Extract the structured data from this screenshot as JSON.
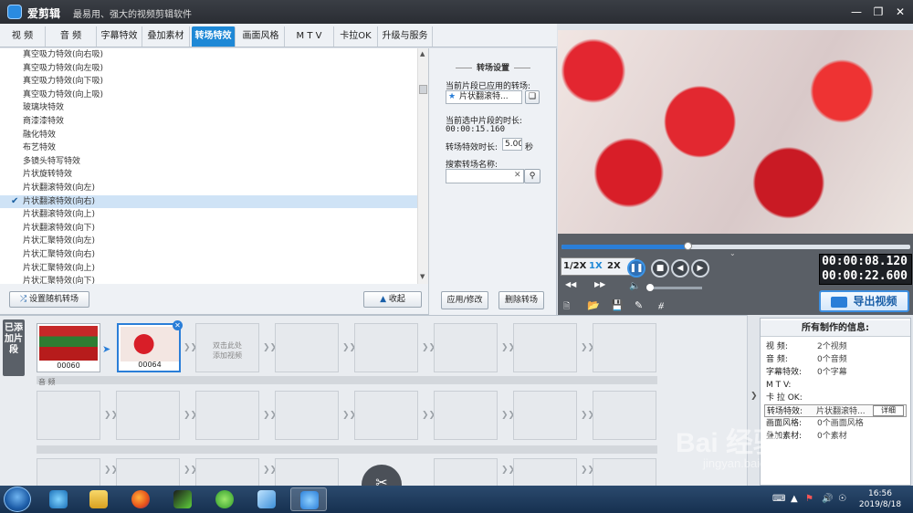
{
  "app": {
    "name": "爱剪辑",
    "slogan": "最易用、强大的视频剪辑软件"
  },
  "tabs": [
    {
      "label": "视 频"
    },
    {
      "label": "音 频"
    },
    {
      "label": "字幕特效"
    },
    {
      "label": "叠加素材"
    },
    {
      "label": "转场特效"
    },
    {
      "label": "画面风格"
    },
    {
      "label": "M T V"
    },
    {
      "label": "卡拉OK"
    },
    {
      "label": "升级与服务"
    }
  ],
  "effects": [
    "真空吸力特效(向右吸)",
    "真空吸力特效(向左吸)",
    "真空吸力特效(向下吸)",
    "真空吸力特效(向上吸)",
    "玻璃块特效",
    "商漆漆特效",
    "融化特效",
    "布艺特效",
    "多镜头特写特效",
    "片状旋转特效",
    "片状翻滚特效(向左)",
    "片状翻滚特效(向右)",
    "片状翻滚特效(向上)",
    "片状翻滚特效(向下)",
    "片状汇聚特效(向左)",
    "片状汇聚特效(向右)",
    "片状汇聚特效(向上)",
    "片状汇聚特效(向下)"
  ],
  "selected_effect_check": "✔",
  "list_buttons": {
    "random": "设置随机转场",
    "collapse": "收起"
  },
  "settings": {
    "title": "转场设置",
    "applied_label": "当前片段已应用的转场:",
    "applied_value": "片状翻滚特...",
    "duration_label": "当前选中片段的时长:",
    "duration_value": "00:00:15.160",
    "effect_duration_label": "转场特效时长:",
    "effect_duration_value": "5.00",
    "seconds_unit": "秒",
    "search_label": "搜索转场名称:",
    "search_value": "",
    "apply_button": "应用/修改",
    "delete_button": "删除转场"
  },
  "player": {
    "speed_half": "1/2X",
    "speed_1x": "1X",
    "speed_2x": "2X",
    "current_time": "00:00:08.120",
    "total_time": "00:00:22.600",
    "progress": 0.36,
    "export_label": "导出视频"
  },
  "timeline": {
    "added_label": "已添加片段",
    "clips": [
      {
        "name": "00060"
      },
      {
        "name": "00064"
      }
    ],
    "add_hint_line1": "双击此处",
    "add_hint_line2": "添加视频",
    "audio_label": "音 频"
  },
  "info": {
    "title": "所有制作的信息:",
    "rows": [
      {
        "key": "视    频:",
        "value": "2个视频"
      },
      {
        "key": "音    频:",
        "value": "0个音频"
      },
      {
        "key": "字幕特效:",
        "value": "0个字幕"
      },
      {
        "key": "M  T  V:",
        "value": ""
      },
      {
        "key": "卡  拉 OK:",
        "value": ""
      },
      {
        "key": "转场特效:",
        "value": "片状翻滚特..."
      },
      {
        "key": "画面风格:",
        "value": "0个画面风格"
      },
      {
        "key": "叠加素材:",
        "value": "0个素材"
      }
    ],
    "detail_button": "详细"
  },
  "taskbar": {
    "time": "16:56",
    "date": "2019/8/18"
  },
  "watermark": {
    "main": "Bai 经验",
    "sub": "jingyan.baidu.com"
  },
  "colors": {
    "accent": "#1e88d6",
    "titlebar": "#2f3238",
    "export_border": "#3d8fe0"
  }
}
